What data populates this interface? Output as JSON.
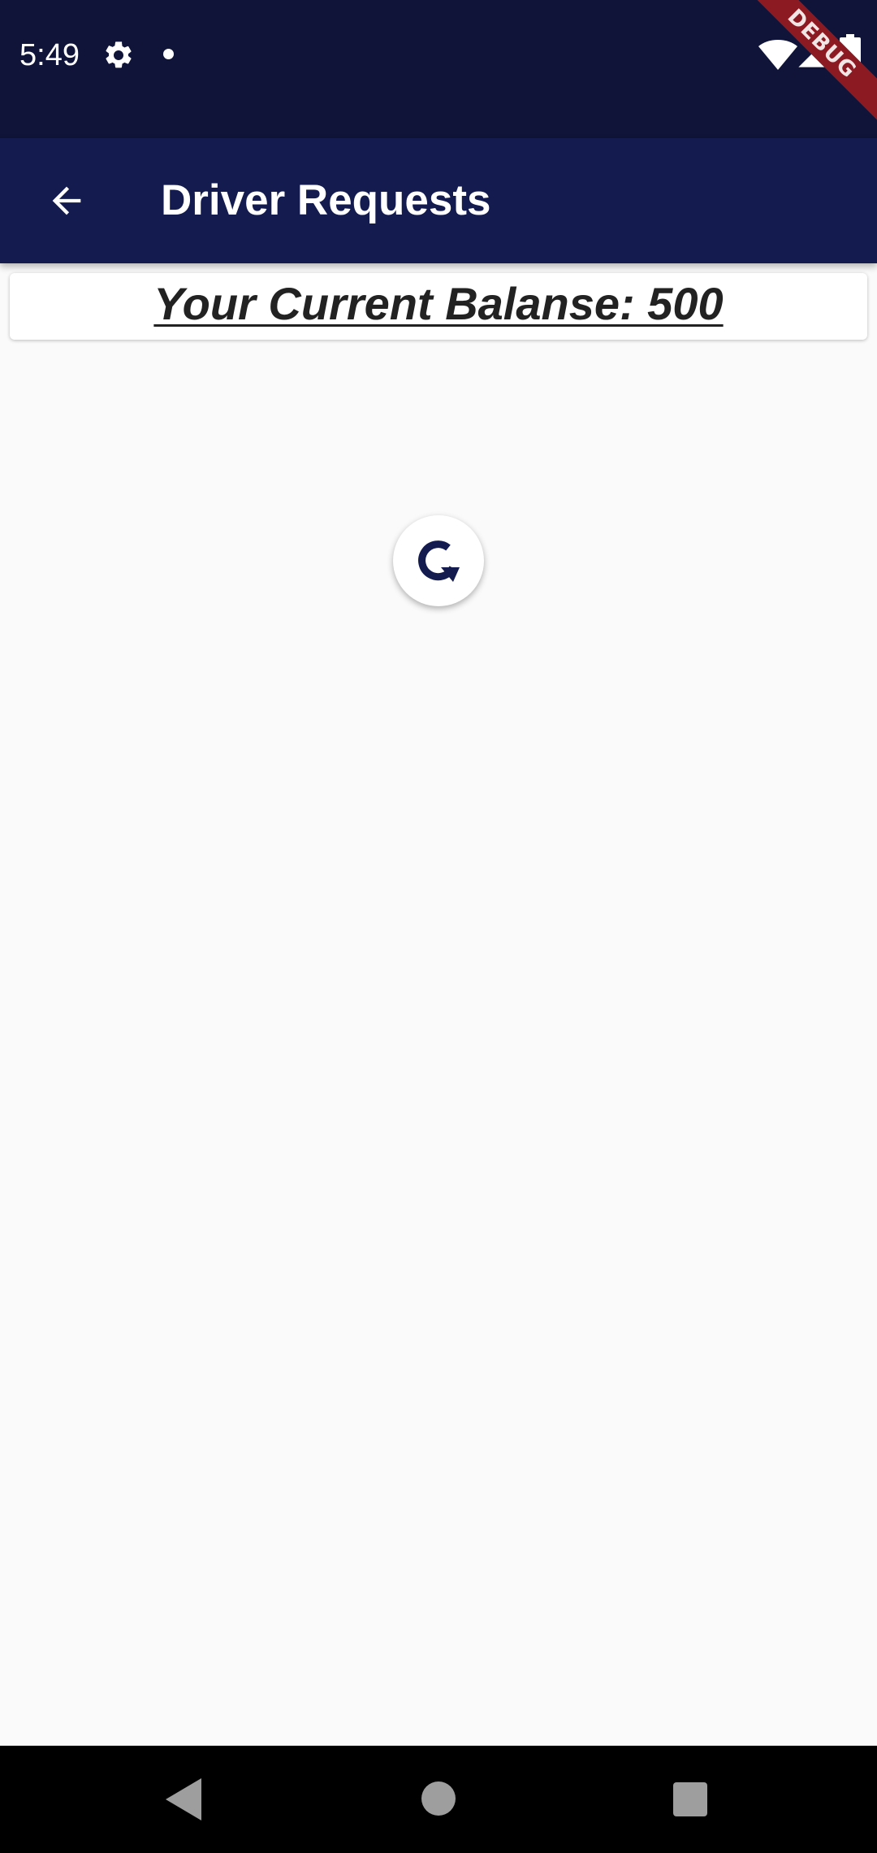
{
  "status_bar": {
    "time": "5:49",
    "icons": [
      "gear-icon",
      "notification-dot-icon",
      "wifi-icon",
      "signal-icon",
      "battery-icon"
    ],
    "debug_label": "DEBUG"
  },
  "app_bar": {
    "back_icon": "arrow-back-icon",
    "title": "Driver Requests"
  },
  "balance": {
    "text": "Your Current Balanse: 500"
  },
  "refresh": {
    "icon": "refresh-icon"
  },
  "nav_bar": {
    "icons": [
      "nav-back-icon",
      "nav-home-icon",
      "nav-recents-icon"
    ]
  },
  "colors": {
    "status_bar_bg": "#0f1438",
    "app_bar_bg": "#131b4f",
    "background": "#fafafa",
    "debug_ribbon": "#8b1a22",
    "refresh_icon": "#131b4f"
  }
}
